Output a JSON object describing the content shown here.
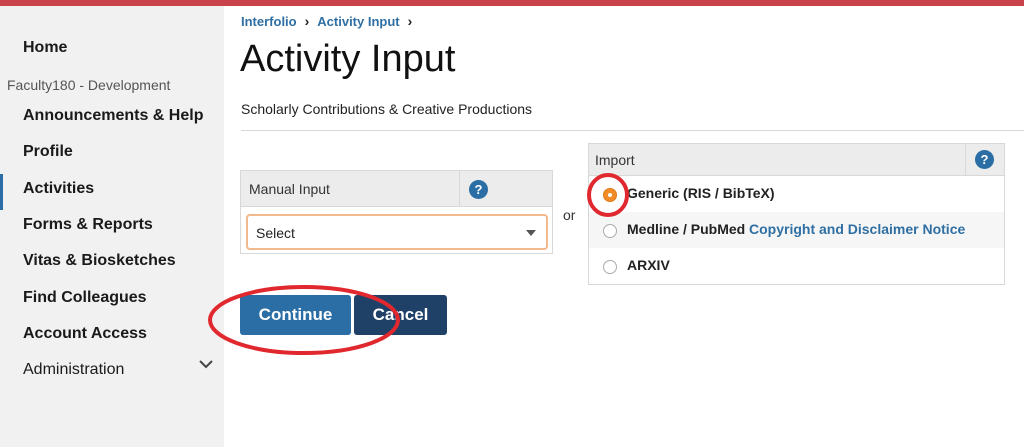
{
  "sidebar": {
    "items": [
      {
        "label": "Home"
      },
      {
        "label": "Faculty180 - Development"
      },
      {
        "label": "Announcements & Help"
      },
      {
        "label": "Profile"
      },
      {
        "label": "Activities"
      },
      {
        "label": "Forms & Reports"
      },
      {
        "label": "Vitas & Biosketches"
      },
      {
        "label": "Find Colleagues"
      },
      {
        "label": "Account Access"
      },
      {
        "label": "Administration"
      }
    ],
    "active_item": "Activities"
  },
  "breadcrumb": [
    "Interfolio",
    "Activity Input"
  ],
  "page": {
    "title": "Activity Input",
    "subtitle": "Scholarly Contributions & Creative Productions"
  },
  "manual_input": {
    "header": "Manual Input",
    "help": "?",
    "select_value": "Select"
  },
  "or_label": "or",
  "import": {
    "header": "Import",
    "help": "?",
    "options": [
      {
        "label": "Generic (RIS / BibTeX)",
        "checked": true
      },
      {
        "label": "Medline / PubMed",
        "link": "Copyright and Disclaimer Notice",
        "checked": false
      },
      {
        "label": "ARXIV",
        "checked": false
      }
    ]
  },
  "buttons": {
    "continue": "Continue",
    "cancel": "Cancel"
  },
  "colors": {
    "accent": "#2a6ea5",
    "top_bar": "#c9424a",
    "annotation": "#e0282e",
    "radio_checked": "#f28c28"
  }
}
